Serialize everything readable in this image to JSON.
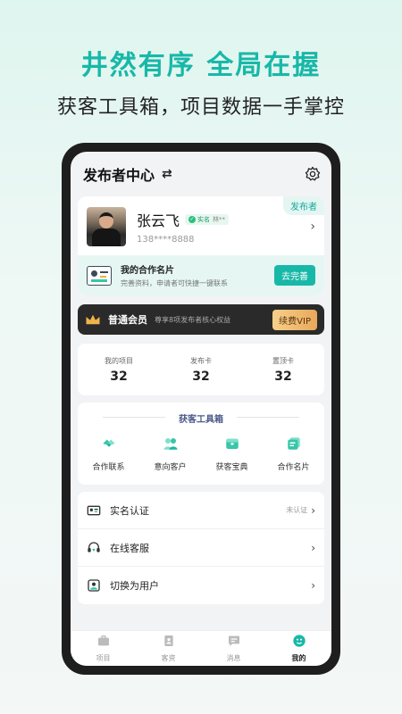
{
  "promo": {
    "headline": "井然有序  全局在握",
    "subline": "获客工具箱，项目数据一手掌控"
  },
  "topbar": {
    "title": "发布者中心",
    "swap_icon": "swap-arrows-icon",
    "settings_icon": "gear-icon"
  },
  "profile": {
    "role_tag": "发布者",
    "name": "张云飞",
    "verified_label": "实名",
    "verified_name": "林**",
    "phone": "138****8888"
  },
  "business_card": {
    "title": "我的合作名片",
    "desc": "完善资料，申请者可快捷一键联系",
    "button": "去完善"
  },
  "vip": {
    "title": "普通会员",
    "desc": "尊享8项发布者核心权益",
    "button": "续费VIP"
  },
  "stats": [
    {
      "label": "我的项目",
      "value": "32"
    },
    {
      "label": "发布卡",
      "value": "32"
    },
    {
      "label": "置顶卡",
      "value": "32"
    }
  ],
  "toolbox": {
    "title": "获客工具箱",
    "items": [
      {
        "label": "合作联系",
        "icon": "handshake-icon"
      },
      {
        "label": "意向客户",
        "icon": "customers-icon"
      },
      {
        "label": "获客宝典",
        "icon": "guidebook-icon"
      },
      {
        "label": "合作名片",
        "icon": "card-stack-icon"
      }
    ]
  },
  "menu": [
    {
      "label": "实名认证",
      "status": "未认证",
      "icon": "id-card-icon"
    },
    {
      "label": "在线客服",
      "status": "",
      "icon": "headset-icon"
    },
    {
      "label": "切换为用户",
      "status": "",
      "icon": "user-switch-icon"
    }
  ],
  "tabs": [
    {
      "label": "项目",
      "icon": "briefcase-icon"
    },
    {
      "label": "客资",
      "icon": "contacts-icon"
    },
    {
      "label": "消息",
      "icon": "message-icon"
    },
    {
      "label": "我的",
      "icon": "profile-icon",
      "active": true
    }
  ],
  "colors": {
    "accent": "#18b8a8",
    "vip_gold": "#e8a85a",
    "dark": "#2a2a2a"
  }
}
